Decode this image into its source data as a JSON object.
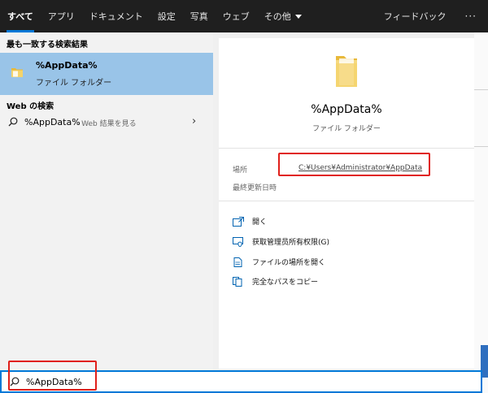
{
  "tabs": [
    {
      "label": "すべて"
    },
    {
      "label": "アプリ"
    },
    {
      "label": "ドキュメント"
    },
    {
      "label": "設定"
    },
    {
      "label": "写真"
    },
    {
      "label": "ウェブ"
    },
    {
      "label": "その他"
    }
  ],
  "header": {
    "feedback_label": "フィードバック",
    "more_label": "···"
  },
  "left": {
    "best_match_title": "最も一致する検索結果",
    "best_match": {
      "name": "%AppData%",
      "type": "ファイル フォルダー"
    },
    "web_title": "Web の検索",
    "web_result": {
      "query": "%AppData%",
      "suffix": " - Web 結果を見る"
    }
  },
  "detail": {
    "name": "%AppData%",
    "type": "ファイル フォルダー",
    "location_label": "場所",
    "location_value": "C:¥Users¥Administrator¥AppData",
    "modified_label": "最終更新日時",
    "actions": [
      {
        "label": "開く",
        "icon": "open-icon"
      },
      {
        "label": "获取管理员所有权限(G)",
        "icon": "admin-shield-icon"
      },
      {
        "label": "ファイルの場所を開く",
        "icon": "file-location-icon"
      },
      {
        "label": "完全なパスをコピー",
        "icon": "copy-path-icon"
      }
    ]
  },
  "search": {
    "query": "%AppData%"
  },
  "colors": {
    "accent": "#0078d7",
    "selection": "#99c4e8",
    "highlight": "#e0201b",
    "folder": "#f4d36b"
  }
}
